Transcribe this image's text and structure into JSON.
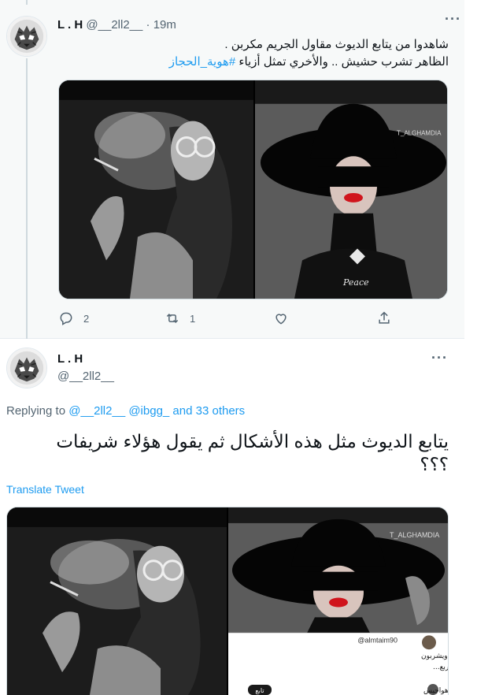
{
  "parent_tweet": {
    "name": "L . H",
    "handle": "@__2ll2__",
    "separator": "·",
    "time": "19m",
    "text_line1": "شاهدوا من يتابع الديوث مقاول الجريم مكربن .",
    "text_line2_main": "الظاهر تشرب حشيش  .. والأخري تمثل أزياء",
    "hashtag": "#هوية_الحجاز",
    "replies_count": "2",
    "retweets_count": "1",
    "menu_icon": "more-dots-icon"
  },
  "focused_tweet": {
    "name": "L . H",
    "handle": "@__2ll2__",
    "replying_prefix": "Replying to",
    "replying_link": "@__2ll2__ @ibgg_ and 33 others",
    "text_line1": "يتابع الديوث مثل هذه الأشكال ثم يقول هؤلاء شريفات",
    "text_line2": "؟؟؟",
    "translate_label": "Translate Tweet",
    "menu_icon": "more-dots-icon"
  },
  "image_text": {
    "watermark": "T_ALGHAMDIA",
    "peace": "Peace",
    "inner_handle": "@almtaim90",
    "inner_line1": "رئيس جمعية اللي يفطرون كبده ويشربون",
    "inner_line2": "#قهوة_كفار و صاحب مقولة #صارحيني مجربع...",
    "inner_follow": "تابع",
    "inner_name2": "هواجيس"
  },
  "colors": {
    "accent": "#1d9bf0",
    "text": "#0f1419",
    "muted": "#536471",
    "thread_line": "#cfd9de",
    "parent_bg": "#f7f9f9"
  }
}
